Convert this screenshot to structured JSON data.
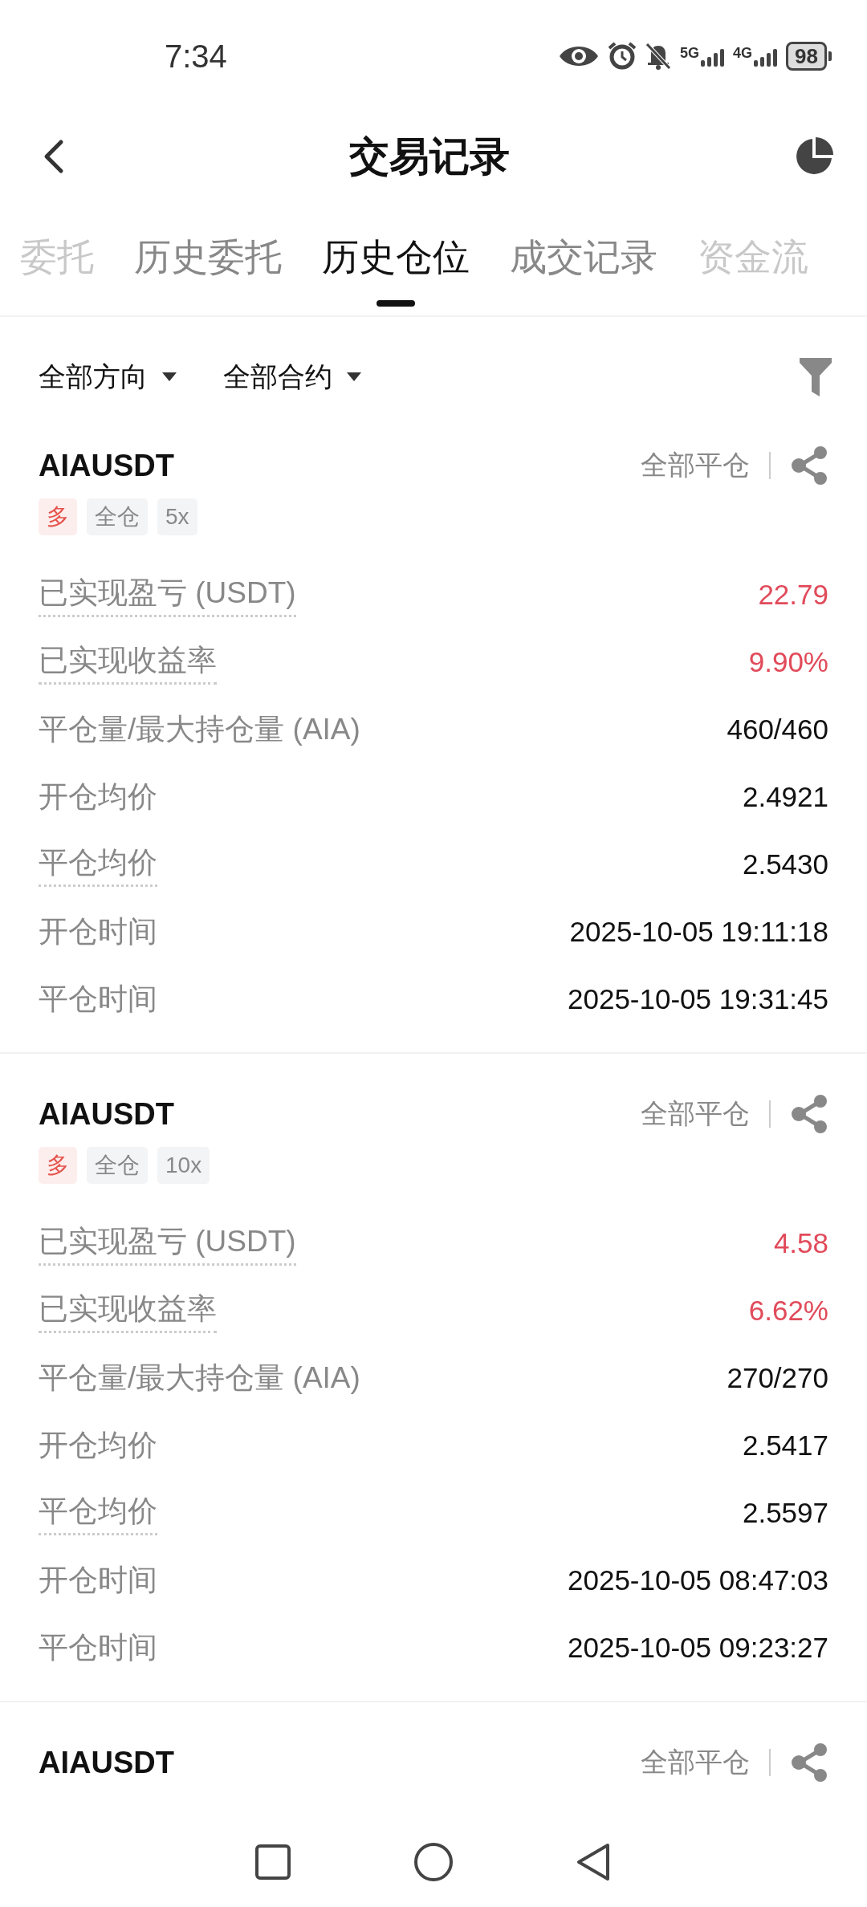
{
  "status_bar": {
    "time": "7:34",
    "networks": [
      "5G",
      "4G"
    ],
    "battery": "98"
  },
  "header": {
    "title": "交易记录"
  },
  "tabs": [
    {
      "label": "委托",
      "selected": false,
      "clipped": true
    },
    {
      "label": "历史委托",
      "selected": false,
      "clipped": false
    },
    {
      "label": "历史仓位",
      "selected": true,
      "clipped": false
    },
    {
      "label": "成交记录",
      "selected": false,
      "clipped": false
    },
    {
      "label": "资金流",
      "selected": false,
      "clipped": true
    }
  ],
  "filters": [
    {
      "label": "全部方向"
    },
    {
      "label": "全部合约"
    }
  ],
  "positions": [
    {
      "symbol": "AIAUSDT",
      "action": "全部平仓",
      "tags": [
        {
          "text": "多",
          "kind": "side"
        },
        {
          "text": "全仓",
          "kind": "plain"
        },
        {
          "text": "5x",
          "kind": "plain"
        }
      ],
      "rows": [
        {
          "label": "已实现盈亏 (USDT)",
          "value": "22.79",
          "dotted": true,
          "highlight": true
        },
        {
          "label": "已实现收益率",
          "value": "9.90%",
          "dotted": true,
          "highlight": true
        },
        {
          "label": "平仓量/最大持仓量 (AIA)",
          "value": "460/460",
          "dotted": false,
          "highlight": false
        },
        {
          "label": "开仓均价",
          "value": "2.4921",
          "dotted": false,
          "highlight": false
        },
        {
          "label": "平仓均价",
          "value": "2.5430",
          "dotted": true,
          "highlight": false
        },
        {
          "label": "开仓时间",
          "value": "2025-10-05 19:11:18",
          "dotted": false,
          "highlight": false
        },
        {
          "label": "平仓时间",
          "value": "2025-10-05 19:31:45",
          "dotted": false,
          "highlight": false
        }
      ]
    },
    {
      "symbol": "AIAUSDT",
      "action": "全部平仓",
      "tags": [
        {
          "text": "多",
          "kind": "side"
        },
        {
          "text": "全仓",
          "kind": "plain"
        },
        {
          "text": "10x",
          "kind": "plain"
        }
      ],
      "rows": [
        {
          "label": "已实现盈亏 (USDT)",
          "value": "4.58",
          "dotted": true,
          "highlight": true
        },
        {
          "label": "已实现收益率",
          "value": "6.62%",
          "dotted": true,
          "highlight": true
        },
        {
          "label": "平仓量/最大持仓量 (AIA)",
          "value": "270/270",
          "dotted": false,
          "highlight": false
        },
        {
          "label": "开仓均价",
          "value": "2.5417",
          "dotted": false,
          "highlight": false
        },
        {
          "label": "平仓均价",
          "value": "2.5597",
          "dotted": true,
          "highlight": false
        },
        {
          "label": "开仓时间",
          "value": "2025-10-05 08:47:03",
          "dotted": false,
          "highlight": false
        },
        {
          "label": "平仓时间",
          "value": "2025-10-05 09:23:27",
          "dotted": false,
          "highlight": false
        }
      ]
    },
    {
      "symbol": "AIAUSDT",
      "action": "全部平仓"
    }
  ]
}
